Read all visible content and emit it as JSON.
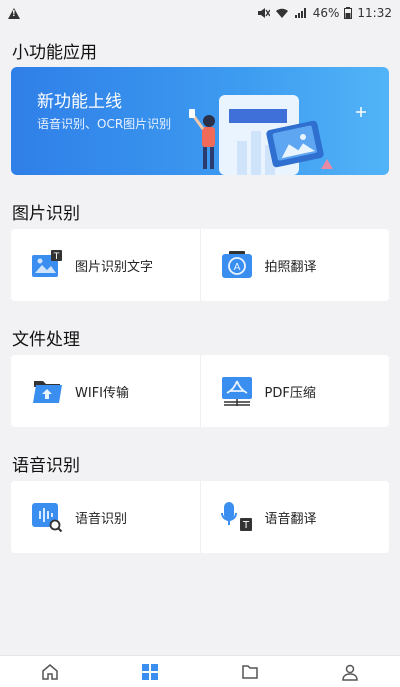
{
  "status_bar": {
    "battery_percent": "46%",
    "time": "11:32"
  },
  "sections": {
    "mini_apps": "小功能应用",
    "image": "图片识别",
    "file": "文件处理",
    "voice": "语音识别"
  },
  "banner": {
    "title": "新功能上线",
    "subtitle": "语音识别、OCR图片识别"
  },
  "items": {
    "image_to_text": "图片识别文字",
    "photo_translate": "拍照翻译",
    "wifi_transfer": "WIFI传输",
    "pdf_compress": "PDF压缩",
    "voice_recognition": "语音识别",
    "voice_translate": "语音翻译"
  },
  "nav": {
    "icons": [
      "home-icon",
      "apps-icon",
      "folder-icon",
      "user-icon"
    ],
    "active_index": 1
  },
  "colors": {
    "accent": "#3a8ef0",
    "background": "#f2f2f4"
  }
}
